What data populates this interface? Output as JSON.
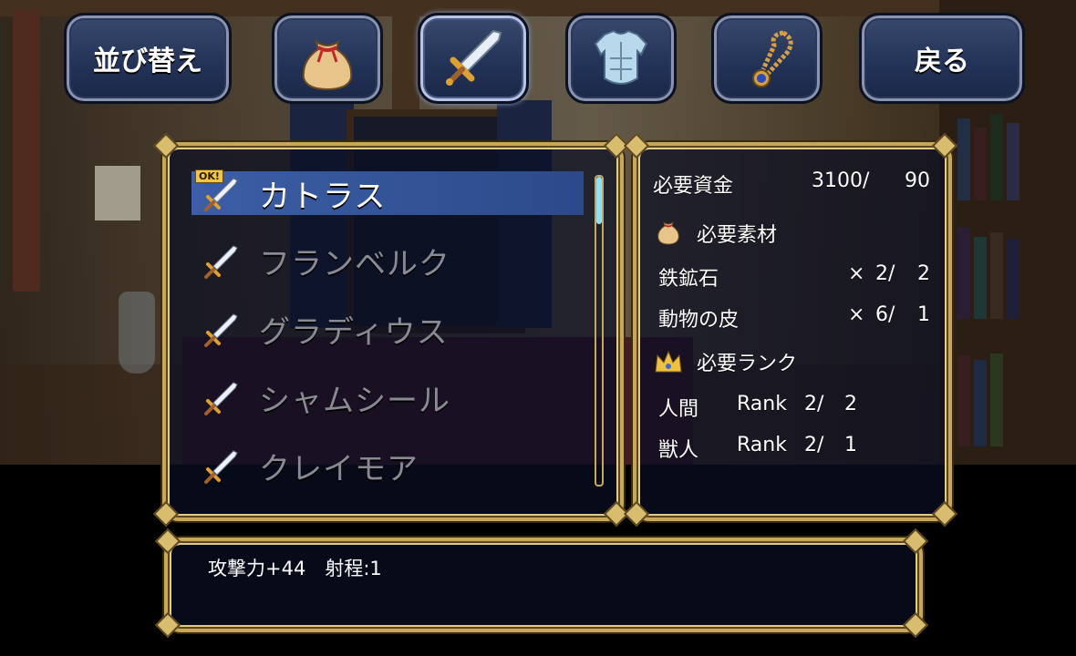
{
  "top_bar": {
    "sort_label": "並び替え",
    "back_label": "戻る",
    "categories": [
      {
        "icon": "bag-icon"
      },
      {
        "icon": "sword-icon"
      },
      {
        "icon": "armor-icon"
      },
      {
        "icon": "necklace-icon"
      }
    ]
  },
  "item_list": {
    "items": [
      {
        "name": "カトラス",
        "selected": true,
        "craftable": true,
        "badge": "OK!"
      },
      {
        "name": "フランベルク",
        "selected": false,
        "craftable": false
      },
      {
        "name": "グラディウス",
        "selected": false,
        "craftable": false
      },
      {
        "name": "シャムシール",
        "selected": false,
        "craftable": false
      },
      {
        "name": "クレイモア",
        "selected": false,
        "craftable": false
      }
    ]
  },
  "requirements": {
    "funds_label": "必要資金",
    "funds_have": "3100/",
    "funds_need": "90",
    "materials_label": "必要素材",
    "materials": [
      {
        "name": "鉄鉱石",
        "times": "×",
        "have": "2/",
        "need": "2"
      },
      {
        "name": "動物の皮",
        "times": "×",
        "have": "6/",
        "need": "1"
      }
    ],
    "rank_label": "必要ランク",
    "ranks": [
      {
        "race": "人間",
        "rank_word": "Rank",
        "have": "2/",
        "need": "2"
      },
      {
        "race": "獣人",
        "rank_word": "Rank",
        "have": "2/",
        "need": "1"
      }
    ]
  },
  "description": {
    "text": "攻撃力+44　射程:1"
  },
  "colors": {
    "frame_gold": "#c7a85a",
    "selected_row": "#3c5ea6",
    "scroll_thumb": "#8fe0ff"
  }
}
